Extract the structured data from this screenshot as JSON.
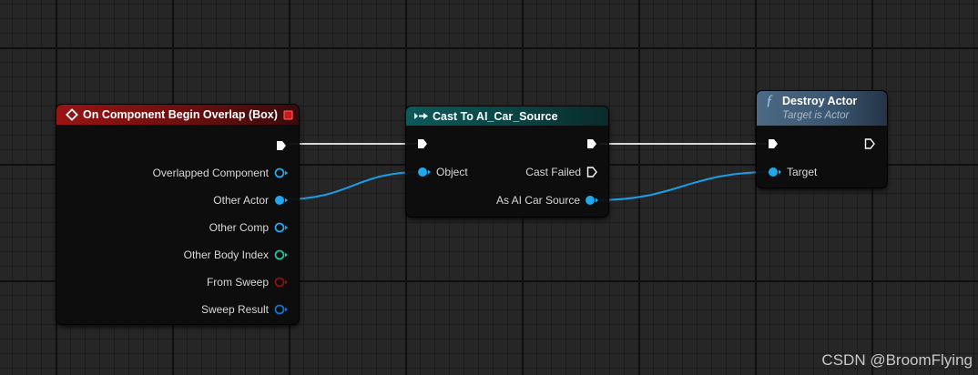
{
  "colors": {
    "exec": "#ffffff",
    "object": "#1ea8f0",
    "int": "#20c0a0",
    "bool": "#8a1010",
    "struct": "#1070d0"
  },
  "nodes": {
    "begin_overlap": {
      "title": "On Component Begin Overlap (Box)",
      "icon": "event-diamond-icon",
      "pins": [
        {
          "label": "Overlapped Component",
          "type": "object"
        },
        {
          "label": "Other Actor",
          "type": "object"
        },
        {
          "label": "Other Comp",
          "type": "object"
        },
        {
          "label": "Other Body Index",
          "type": "int"
        },
        {
          "label": "From Sweep",
          "type": "bool"
        },
        {
          "label": "Sweep Result",
          "type": "struct"
        }
      ]
    },
    "cast": {
      "title": "Cast To AI_Car_Source",
      "icon": "cast-arrows-icon",
      "object_label": "Object",
      "failed_label": "Cast Failed",
      "as_label": "As AI Car Source"
    },
    "destroy": {
      "title": "Destroy Actor",
      "subtitle": "Target is Actor",
      "icon": "function-f-icon",
      "target_label": "Target"
    }
  },
  "watermark": "CSDN @BroomFlying"
}
